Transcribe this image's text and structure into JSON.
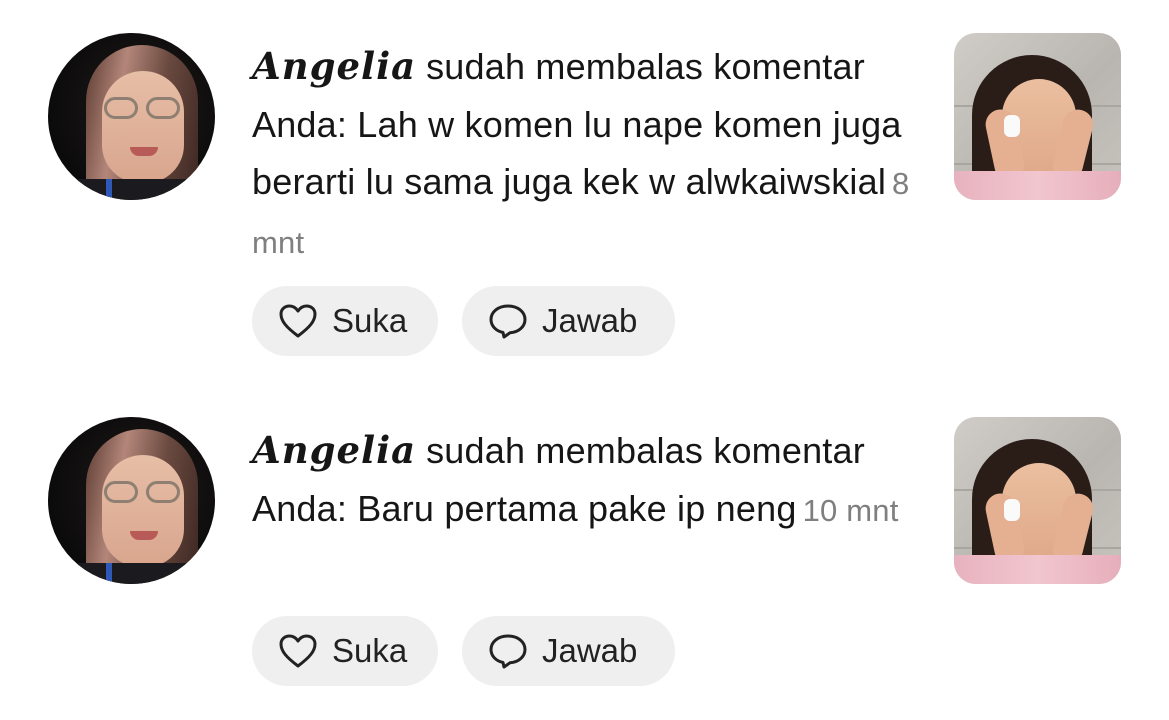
{
  "notifications": [
    {
      "user_name": "𝑨𝒏𝒈𝒆𝒍𝒊𝒂",
      "action_text": "sudah membalas komentar Anda: Lah w komen lu nape komen juga berarti lu sama juga kek w alwkaiwskial",
      "time": "8 mnt",
      "like_label": "Suka",
      "reply_label": "Jawab",
      "avatar_icon": "user-avatar",
      "thumbnail_icon": "video-thumbnail"
    },
    {
      "user_name": "𝑨𝒏𝒈𝒆𝒍𝒊𝒂",
      "action_text": "sudah membalas komentar Anda: Baru pertama pake ip neng",
      "time": "10 mnt",
      "like_label": "Suka",
      "reply_label": "Jawab",
      "avatar_icon": "user-avatar",
      "thumbnail_icon": "video-thumbnail"
    }
  ],
  "icons": {
    "like": "heart-outline-icon",
    "reply": "speech-bubble-icon"
  }
}
